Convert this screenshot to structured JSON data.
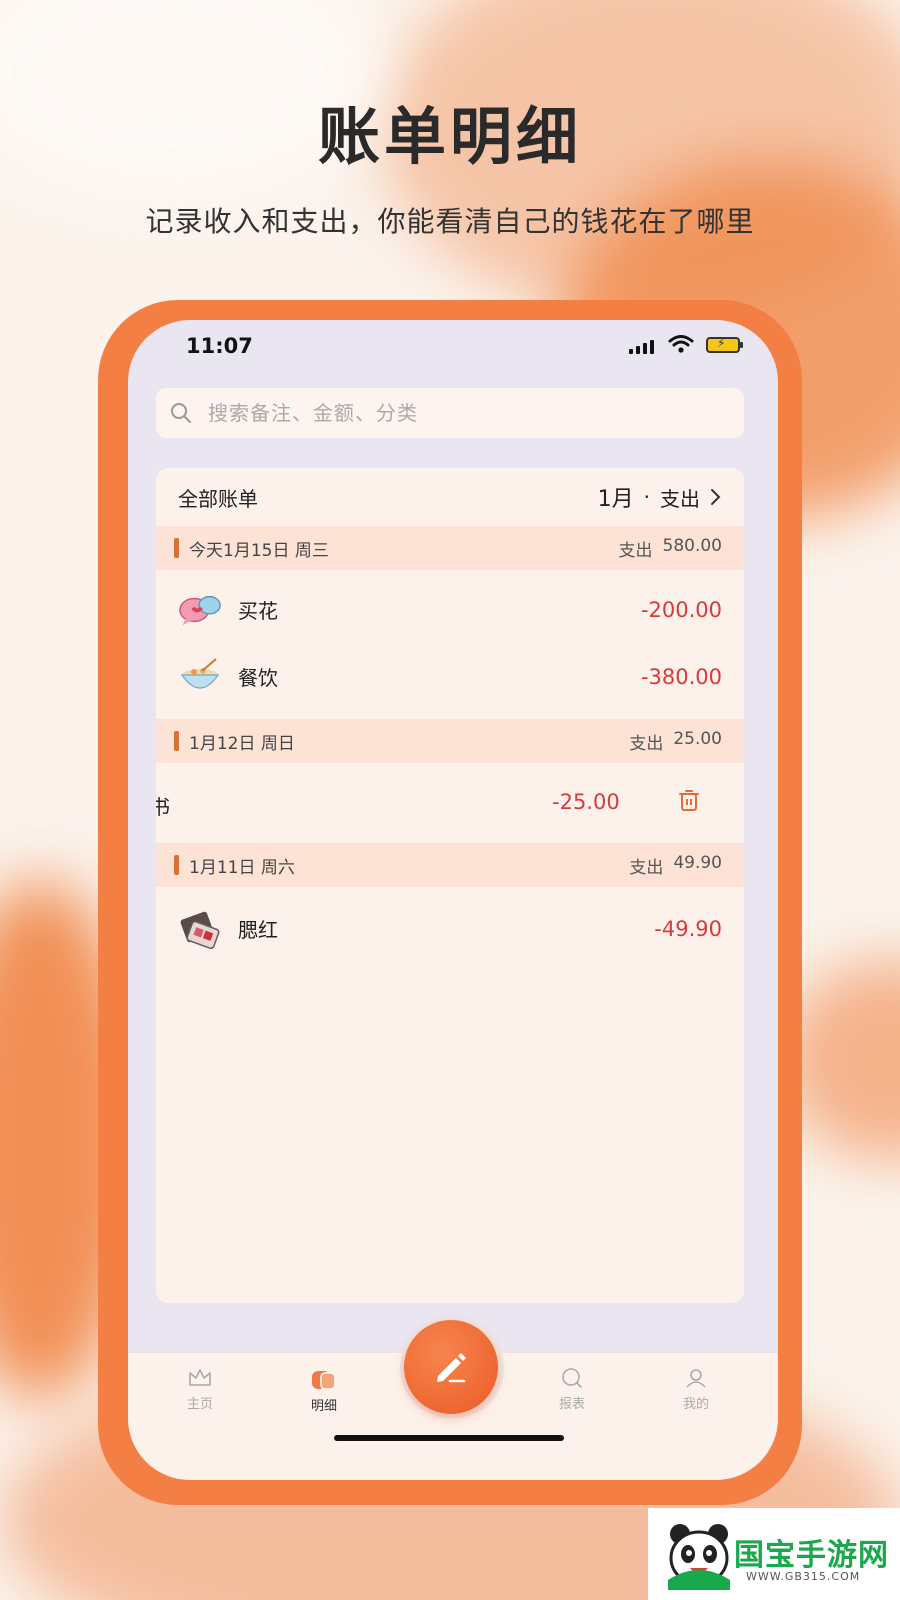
{
  "promo": {
    "title": "账单明细",
    "subtitle": "记录收入和支出，你能看清自己的钱花在了哪里"
  },
  "status_bar": {
    "time": "11:07"
  },
  "search": {
    "placeholder": "搜索备注、金额、分类"
  },
  "bill_card": {
    "title": "全部账单",
    "filter_month": "1月",
    "filter_sep": "·",
    "filter_type": "支出"
  },
  "days": [
    {
      "date": "今天1月15日 周三",
      "summary_label": "支出",
      "summary_amount": "580.00",
      "items": [
        {
          "name": "买花",
          "amount": "-200.00",
          "icon": "flower-chat-icon"
        },
        {
          "name": "餐饮",
          "amount": "-380.00",
          "icon": "food-bowl-icon"
        }
      ]
    },
    {
      "date": "1月12日 周日",
      "summary_label": "支出",
      "summary_amount": "25.00",
      "items": [
        {
          "name": "买书",
          "name_visible": "书",
          "name_cut": "买",
          "amount": "-25.00",
          "icon": "delete-icon"
        }
      ]
    },
    {
      "date": "1月11日 周六",
      "summary_label": "支出",
      "summary_amount": "49.90",
      "items": [
        {
          "name": "腮红",
          "amount": "-49.90",
          "icon": "blush-palette-icon"
        }
      ]
    }
  ],
  "tabs": [
    {
      "label": "主页",
      "icon": "crown-home-icon"
    },
    {
      "label": "明细",
      "icon": "detail-icon"
    },
    {
      "label": "报表",
      "icon": "report-icon"
    },
    {
      "label": "我的",
      "icon": "profile-icon"
    }
  ],
  "active_tab": "明细",
  "watermark": {
    "brand": "国宝手游网",
    "url": "WWW.GB315.COM"
  },
  "colors": {
    "accent": "#f47f45",
    "expense": "#d63b3b",
    "day_header": "#fde3d6"
  }
}
